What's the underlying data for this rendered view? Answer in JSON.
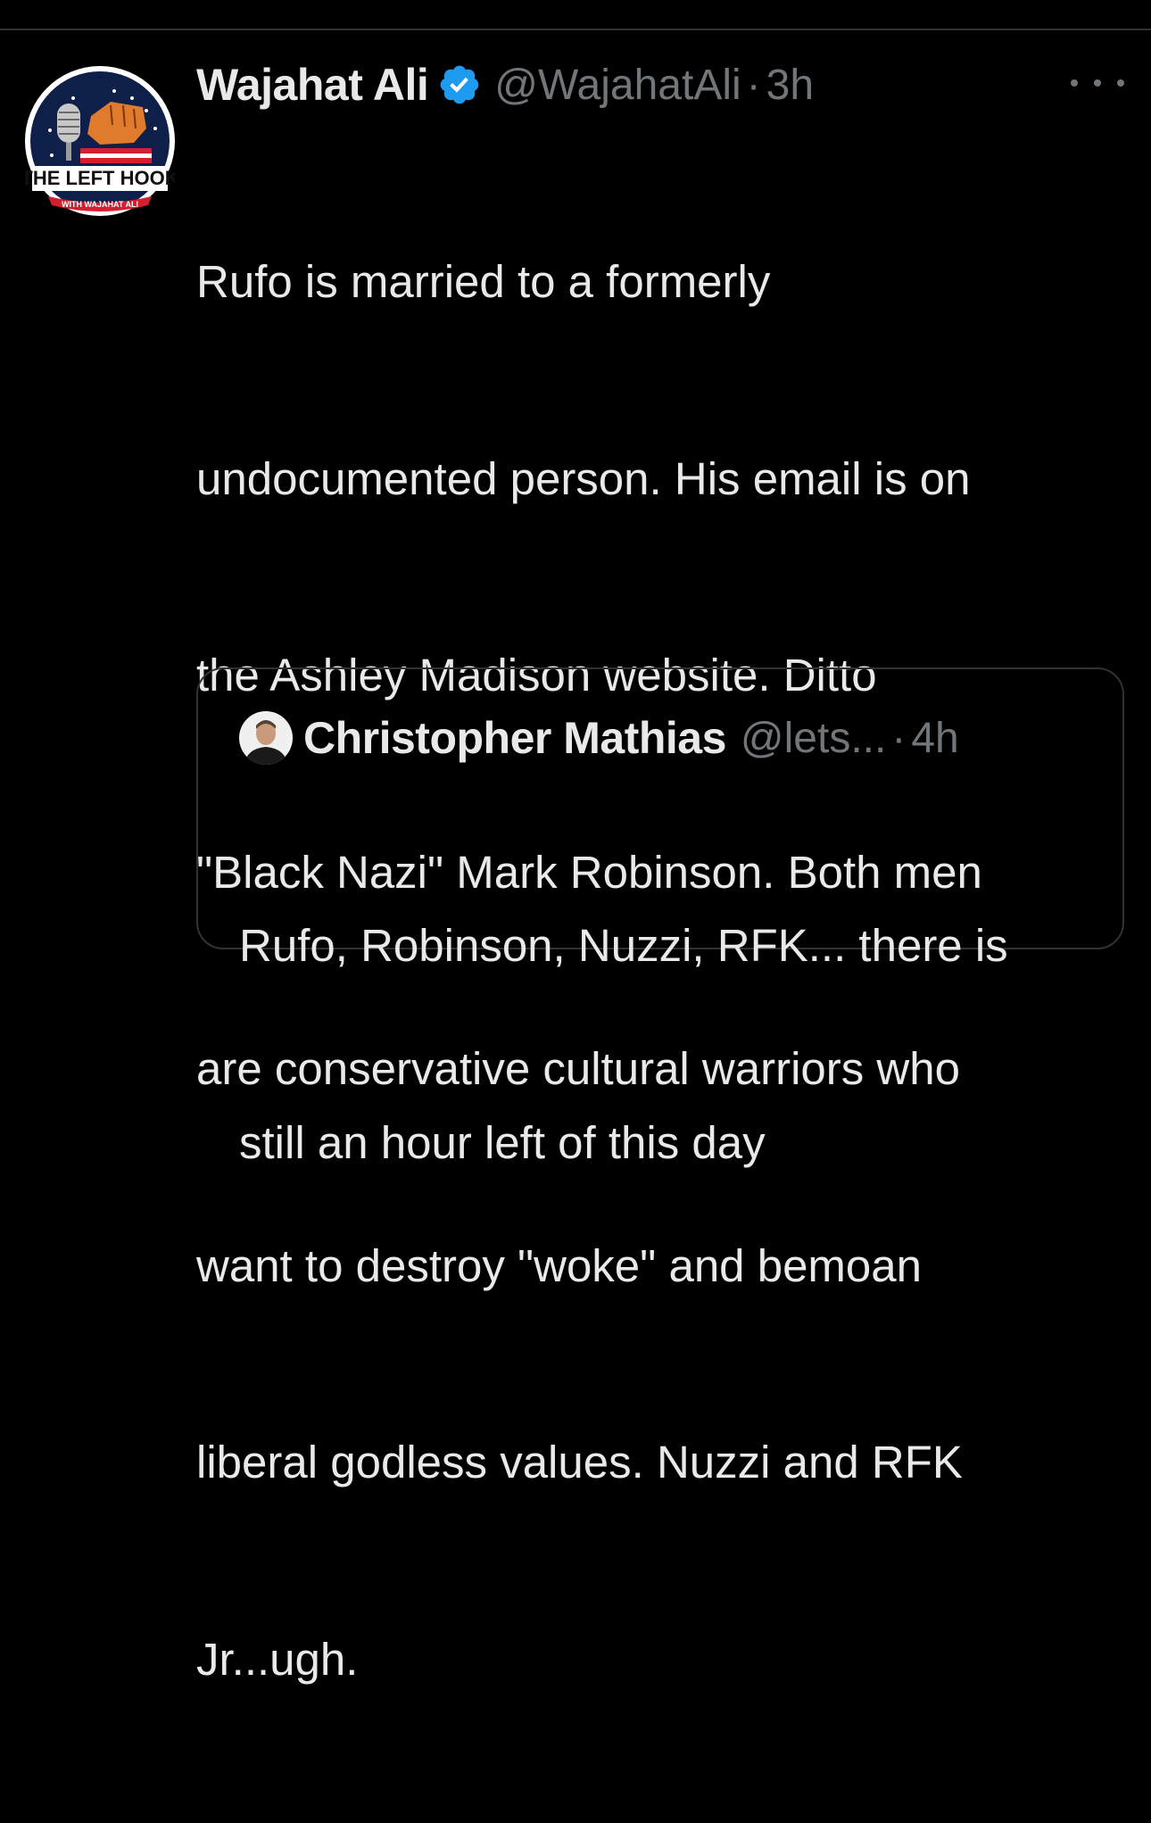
{
  "tweet": {
    "display_name": "Wajahat Ali",
    "handle": "@WajahatAli",
    "separator": "·",
    "time": "3h",
    "avatar_text_top": "THE LEFT HOOK",
    "avatar_text_bottom": "WITH WAJAHAT ALI",
    "body_lines": [
      "Rufo is married to a formerly",
      "undocumented person. His email is on",
      "the Ashley Madison website. Ditto",
      "\"Black Nazi\" Mark Robinson. Both men",
      "are conservative cultural warriors who",
      "want to destroy \"woke\" and bemoan",
      "liberal godless values. Nuzzi and RFK",
      "Jr...ugh."
    ]
  },
  "quote": {
    "display_name": "Christopher Mathias",
    "handle": "@lets...",
    "separator": "·",
    "time": "4h",
    "body_lines": [
      "Rufo, Robinson, Nuzzi, RFK... there is",
      "still an hour left of this day"
    ]
  },
  "icons": {
    "verified": "verified-badge-icon",
    "more": "more-options-icon"
  },
  "colors": {
    "background": "#000000",
    "text": "#e7e9ea",
    "secondary": "#71767b",
    "verified": "#1d9bf0",
    "border": "#2f3336"
  }
}
